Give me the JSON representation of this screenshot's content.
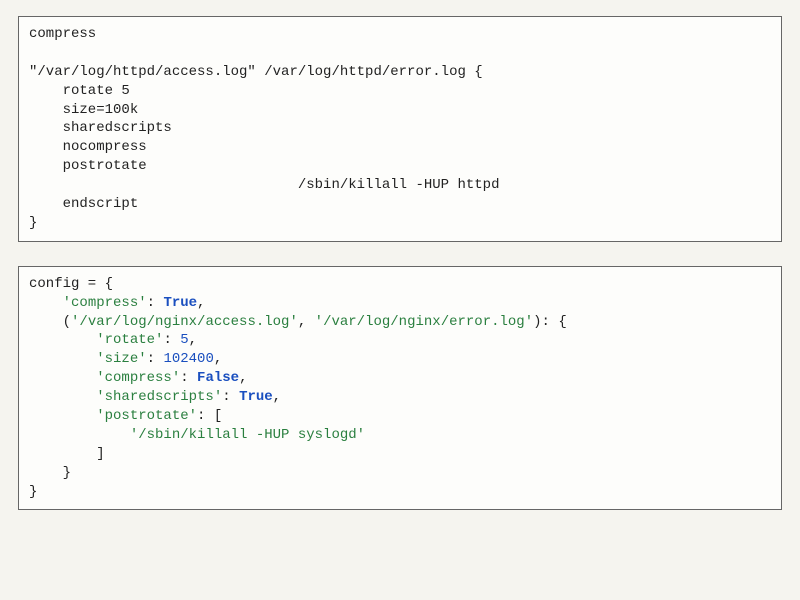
{
  "box1": {
    "l1": "compress",
    "l2": "",
    "l3": "\"/var/log/httpd/access.log\" /var/log/httpd/error.log {",
    "l4": "    rotate 5",
    "l5": "    size=100k",
    "l6": "    sharedscripts",
    "l7": "    nocompress",
    "l8": "    postrotate",
    "l9": "                                /sbin/killall -HUP httpd",
    "l10": "    endscript",
    "l11": "}"
  },
  "box2": {
    "l1": {
      "a": "config = {"
    },
    "l2": {
      "a": "    ",
      "s": "'compress'",
      "b": ": ",
      "bv": "True",
      "c": ","
    },
    "l3": {
      "a": "    (",
      "s1": "'/var/log/nginx/access.log'",
      "b": ", ",
      "s2": "'/var/log/nginx/error.log'",
      "c": "): {"
    },
    "l4": {
      "a": "        ",
      "s": "'rotate'",
      "b": ": ",
      "nv": "5",
      "c": ","
    },
    "l5": {
      "a": "        ",
      "s": "'size'",
      "b": ": ",
      "nv": "102400",
      "c": ","
    },
    "l6": {
      "a": "        ",
      "s": "'compress'",
      "b": ": ",
      "bv": "False",
      "c": ","
    },
    "l7": {
      "a": "        ",
      "s": "'sharedscripts'",
      "b": ": ",
      "bv": "True",
      "c": ","
    },
    "l8": {
      "a": "        ",
      "s": "'postrotate'",
      "b": ": ["
    },
    "l9": {
      "a": "            ",
      "s": "'/sbin/killall -HUP syslogd'"
    },
    "l10": {
      "a": "        ]"
    },
    "l11": {
      "a": "    }"
    },
    "l12": {
      "a": "}"
    }
  }
}
